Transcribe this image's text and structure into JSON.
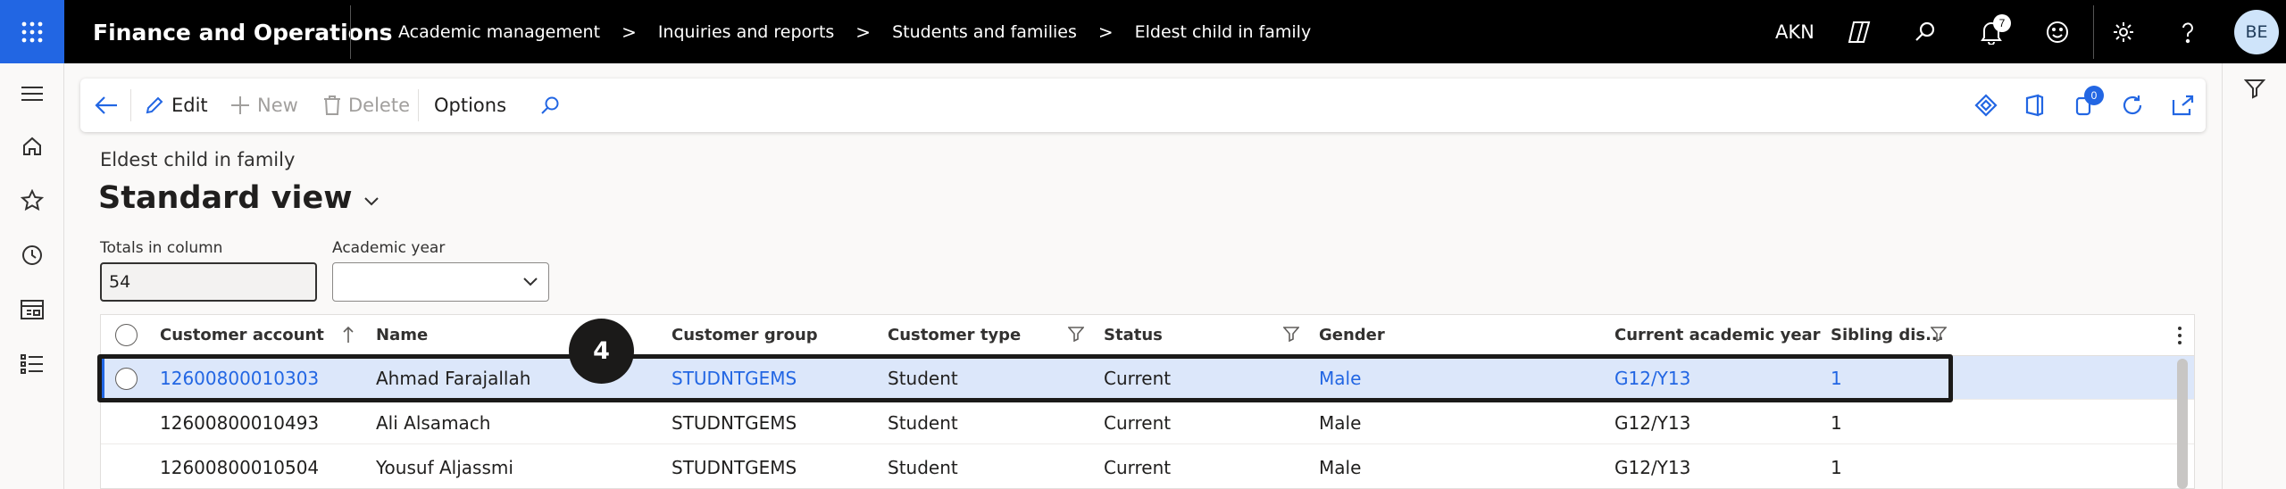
{
  "topbar": {
    "app_title": "Finance and Operations",
    "breadcrumbs": [
      "Academic management",
      "Inquiries and reports",
      "Students and families",
      "Eldest child in family"
    ],
    "breadcrumb_separator": ">",
    "company": "AKN",
    "notification_count": "7",
    "user_initials": "BE",
    "accent_color": "#2266e3"
  },
  "action_pane": {
    "edit_label": "Edit",
    "new_label": "New",
    "delete_label": "Delete",
    "options_label": "Options",
    "attachments_count": "0"
  },
  "page": {
    "caption": "Eldest child in family",
    "view_name": "Standard view"
  },
  "filters": {
    "totals_label": "Totals in column",
    "totals_value": "54",
    "year_label": "Academic year",
    "year_value": ""
  },
  "grid": {
    "columns": [
      "Customer account",
      "Name",
      "Customer group",
      "Customer type",
      "Status",
      "Gender",
      "Current academic year",
      "Sibling dis..."
    ],
    "rows": [
      {
        "account": "12600800010303",
        "name": "Ahmad Farajallah",
        "group": "STUDNTGEMS",
        "type": "Student",
        "status": "Current",
        "gender": "Male",
        "year": "G12/Y13",
        "sibling": "1",
        "selected": true
      },
      {
        "account": "12600800010493",
        "name": "Ali Alsamach",
        "group": "STUDNTGEMS",
        "type": "Student",
        "status": "Current",
        "gender": "Male",
        "year": "G12/Y13",
        "sibling": "1",
        "selected": false
      },
      {
        "account": "12600800010504",
        "name": "Yousuf Aljassmi",
        "group": "STUDNTGEMS",
        "type": "Student",
        "status": "Current",
        "gender": "Male",
        "year": "G12/Y13",
        "sibling": "1",
        "selected": false
      }
    ]
  },
  "annotation": {
    "step_number": "4"
  }
}
